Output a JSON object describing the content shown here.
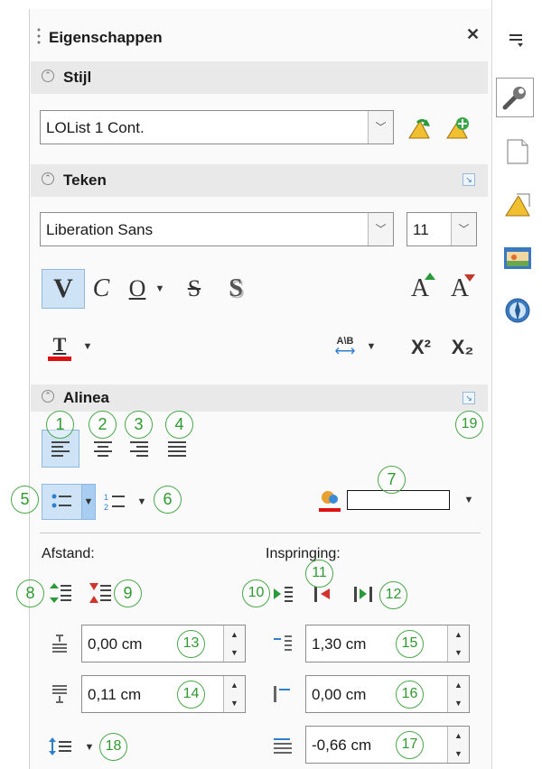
{
  "panel": {
    "title": "Eigenschappen",
    "close_glyph": "✕"
  },
  "style_section": {
    "title": "Stijl",
    "style_value": "LOList 1 Cont."
  },
  "char_section": {
    "title": "Teken",
    "font_name": "Liberation Sans",
    "font_size": "11",
    "bold_glyph": "V",
    "italic_glyph": "C",
    "underline_glyph": "O",
    "strike_glyph": "S",
    "shadow_glyph": "S",
    "grow_glyph": "A",
    "shrink_glyph": "A",
    "superscript_glyph": "X²",
    "subscript_glyph": "X₂",
    "spacing_glyph": "A\\B",
    "fontcolor_glyph": "T"
  },
  "para_section": {
    "title": "Alinea",
    "spacing_label": "Afstand:",
    "indent_label": "Inspringing:",
    "above_value": "0,00 cm",
    "below_value": "0,11 cm",
    "before_value": "1,30 cm",
    "after_value": "0,00 cm",
    "firstline_value": "-0,66 cm"
  },
  "callouts": {
    "n1": "1",
    "n2": "2",
    "n3": "3",
    "n4": "4",
    "n5": "5",
    "n6": "6",
    "n7": "7",
    "n8": "8",
    "n9": "9",
    "n10": "10",
    "n11": "11",
    "n12": "12",
    "n13": "13",
    "n14": "14",
    "n15": "15",
    "n16": "16",
    "n17": "17",
    "n18": "18",
    "n19": "19"
  },
  "colors": {
    "accent": "#3a78c0",
    "callout": "#2f9a2f",
    "selected_bg": "#cfe3f7",
    "section_bg": "#e9e9e9"
  }
}
